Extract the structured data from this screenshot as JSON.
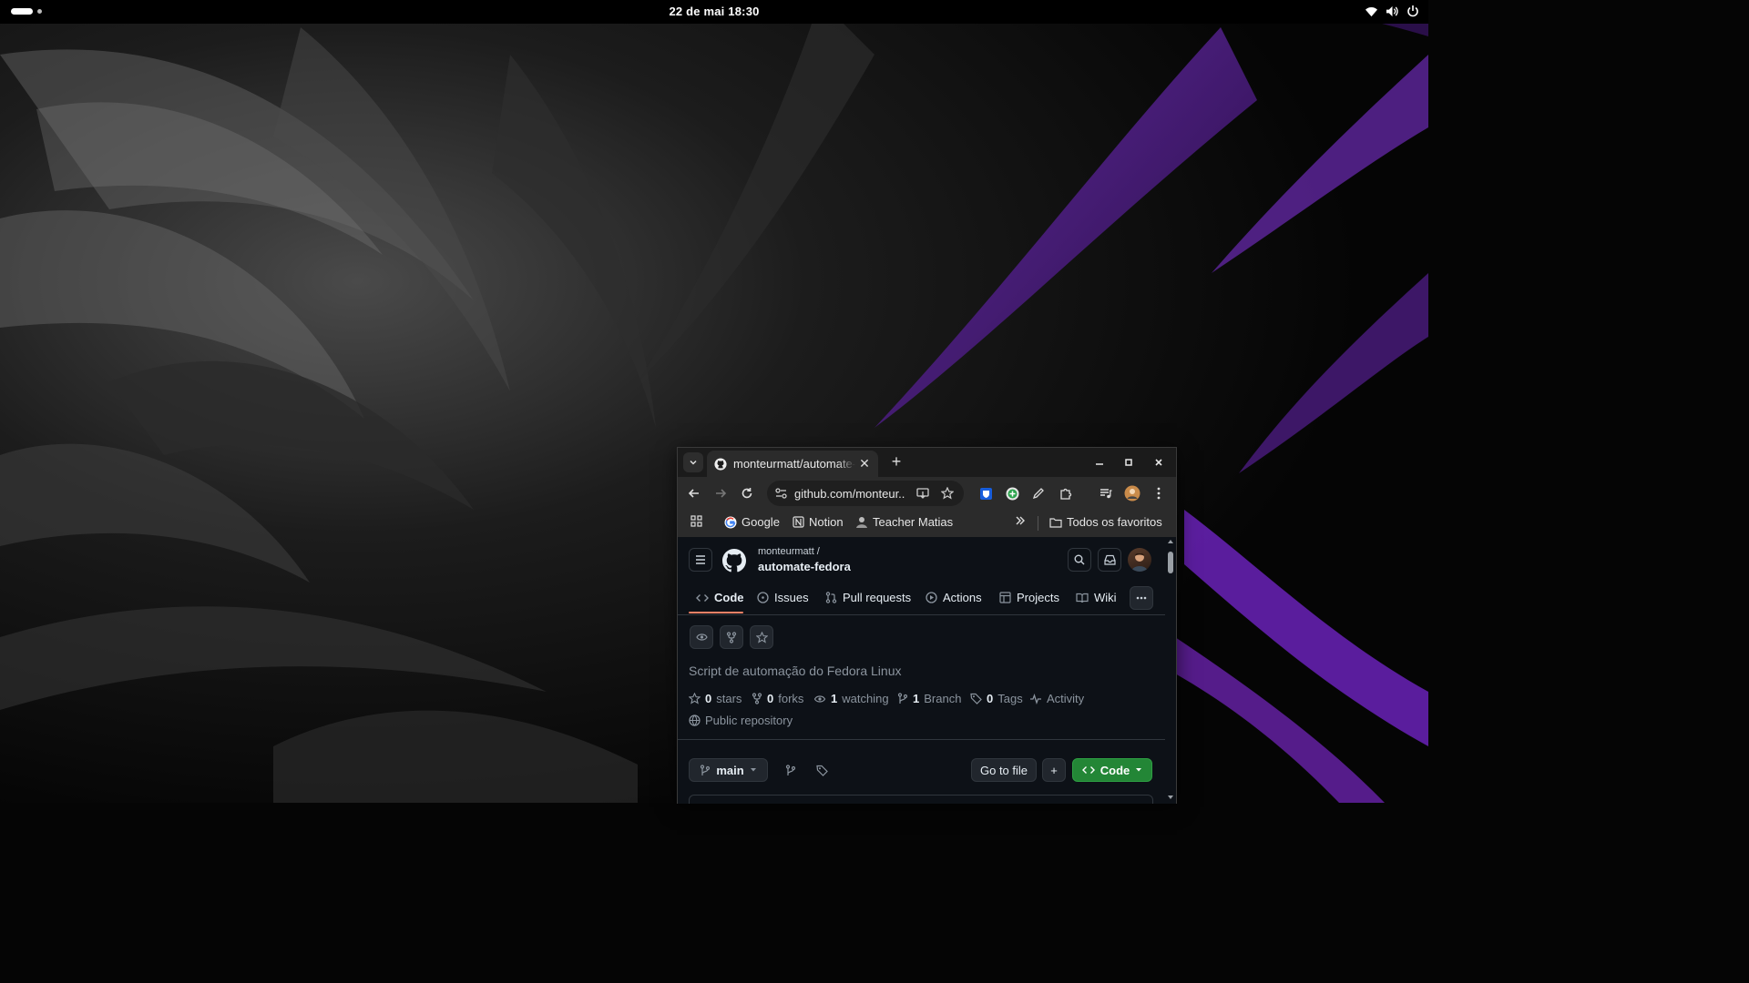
{
  "desktop": {
    "clock": "22 de mai  18:30"
  },
  "browser": {
    "tab": {
      "title": "monteurmatt/automate-fedora"
    },
    "url": "github.com/monteur...",
    "bookmarks": [
      {
        "label": "Google",
        "icon": "google-icon"
      },
      {
        "label": "Notion",
        "icon": "notion-icon"
      },
      {
        "label": "Teacher Matias",
        "icon": "teacher-icon"
      }
    ],
    "all_bookmarks_label": "Todos os favoritos"
  },
  "github": {
    "owner": "monteurmatt /",
    "repo_name": "automate-fedora",
    "nav": [
      "Code",
      "Issues",
      "Pull requests",
      "Actions",
      "Projects",
      "Wiki"
    ],
    "description": "Script de automação do Fedora Linux",
    "stats": {
      "stars_count": "0",
      "stars_label": "stars",
      "forks_count": "0",
      "forks_label": "forks",
      "watching_count": "1",
      "watching_label": "watching",
      "branch_count": "1",
      "branch_label": "Branch",
      "tags_count": "0",
      "tags_label": "Tags",
      "activity_label": "Activity",
      "visibility": "Public repository"
    },
    "branch_selector": "main",
    "go_to_file": "Go to file",
    "add_label": "+",
    "code_button": "Code"
  },
  "colors": {
    "accent_green": "#238636",
    "nav_underline": "#f78166",
    "page_bg": "#0d1117"
  }
}
